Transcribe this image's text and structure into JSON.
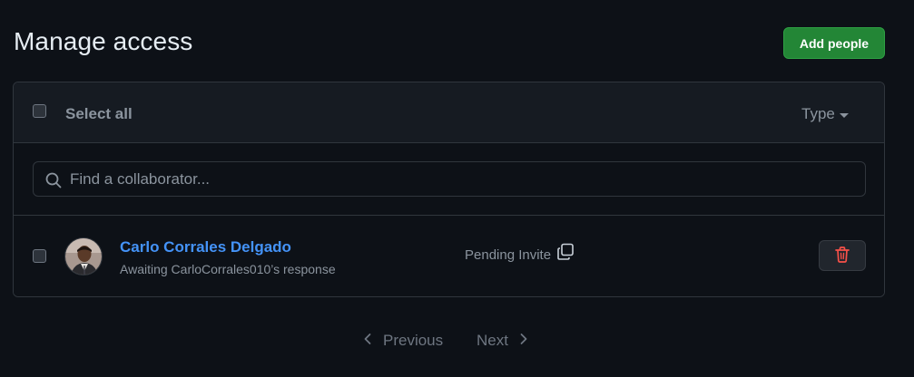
{
  "page": {
    "title": "Manage access",
    "add_button_label": "Add people"
  },
  "list_header": {
    "select_all_label": "Select all",
    "type_filter_label": "Type"
  },
  "search": {
    "placeholder": "Find a collaborator..."
  },
  "members": [
    {
      "name": "Carlo Corrales Delgado",
      "subtitle": "Awaiting CarloCorrales010’s response",
      "status": "Pending Invite",
      "avatar_icon": "user-avatar",
      "copy_icon": "copy-icon",
      "delete_icon": "trash-icon"
    }
  ],
  "pagination": {
    "previous_label": "Previous",
    "next_label": "Next"
  },
  "colors": {
    "background": "#0d1117",
    "panel_header": "#161b22",
    "border": "#30363d",
    "accent_green": "#238636",
    "link_blue": "#4493f8",
    "danger_red": "#f85149",
    "muted_text": "#8b949e"
  }
}
